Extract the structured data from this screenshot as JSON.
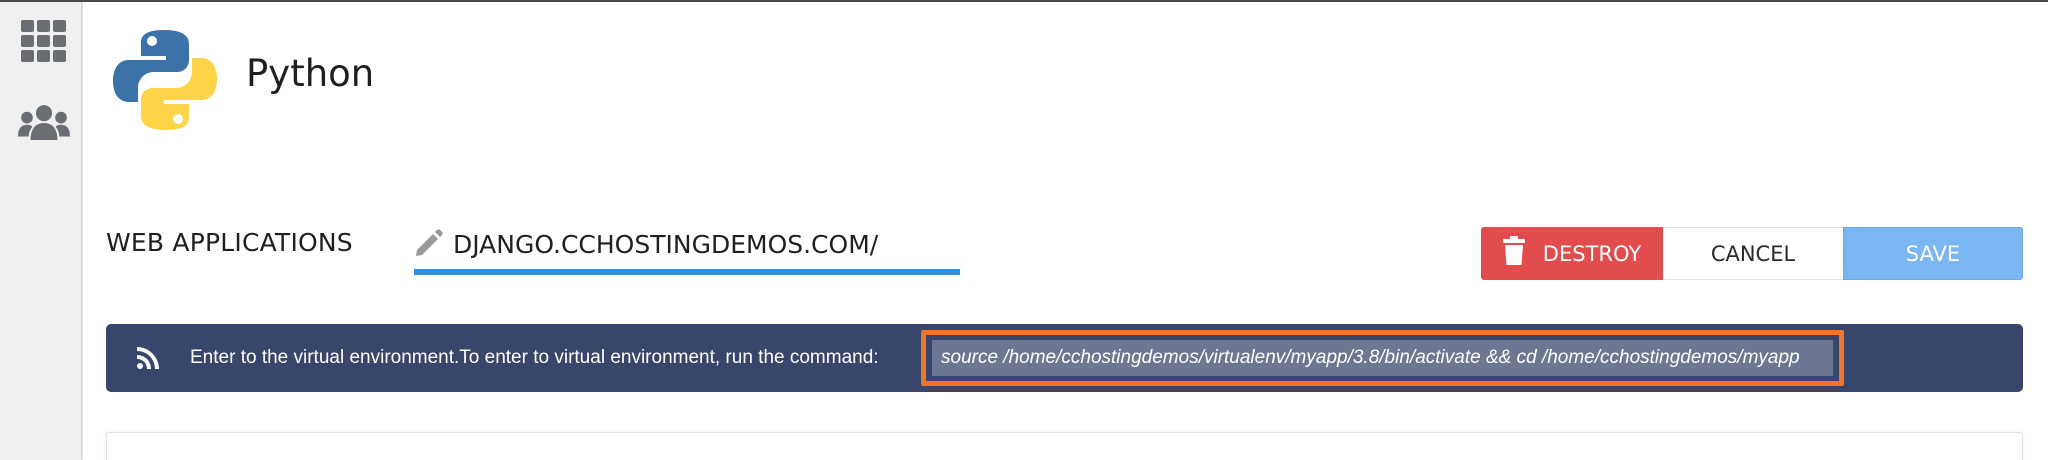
{
  "app": {
    "title": "Python",
    "logo_icon": "python-logo"
  },
  "sidebar": {
    "items": [
      {
        "icon": "apps-grid-icon"
      },
      {
        "icon": "users-icon"
      }
    ]
  },
  "section": {
    "label": "WEB APPLICATIONS",
    "app_name": "DJANGO.CCHOSTINGDEMOS.COM/",
    "edit_icon": "pencil-icon",
    "underline_color": "#2f8de4"
  },
  "actions": {
    "destroy_label": "DESTROY",
    "destroy_icon": "trash-icon",
    "cancel_label": "CANCEL",
    "save_label": "SAVE",
    "destroy_color": "#e24c4d",
    "save_color": "#7ab6f1"
  },
  "notice": {
    "icon": "rss-feed-icon",
    "message": "Enter to the virtual environment.To enter to virtual environment, run the command:",
    "command": "source /home/cchostingdemos/virtualenv/myapp/3.8/bin/activate && cd /home/cchostingdemos/myapp",
    "background_color": "#39466b",
    "highlight_color": "#ed7631"
  }
}
